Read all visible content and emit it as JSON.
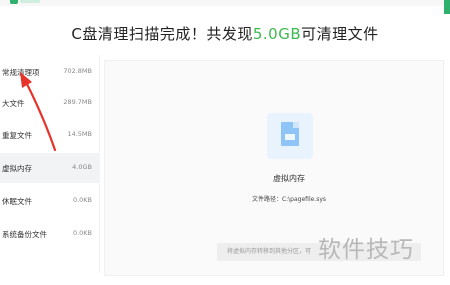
{
  "header": {
    "headline_prefix": "C盘清理扫描完成！共发现",
    "headline_size": "5.0GB",
    "headline_suffix": "可清理文件"
  },
  "sidebar": {
    "items": [
      {
        "label": "常规清理项",
        "size": "702.8MB",
        "active": false
      },
      {
        "label": "大文件",
        "size": "289.7MB",
        "active": false
      },
      {
        "label": "重复文件",
        "size": "14.5MB",
        "active": false
      },
      {
        "label": "虚拟内存",
        "size": "4.0GB",
        "active": true
      },
      {
        "label": "休眠文件",
        "size": "0.0KB",
        "active": false
      },
      {
        "label": "系统备份文件",
        "size": "0.0KB",
        "active": false
      }
    ]
  },
  "detail": {
    "icon": "file-icon",
    "title": "虚拟内存",
    "path": "文件路径：C:\\pagefile.sys",
    "note": "将虚拟内存转移到其他分区，可"
  },
  "watermark": "软件技巧",
  "colors": {
    "accent_green": "#3cb84e",
    "arrow_red": "#e8332a",
    "active_bg": "#f2f3f5"
  }
}
